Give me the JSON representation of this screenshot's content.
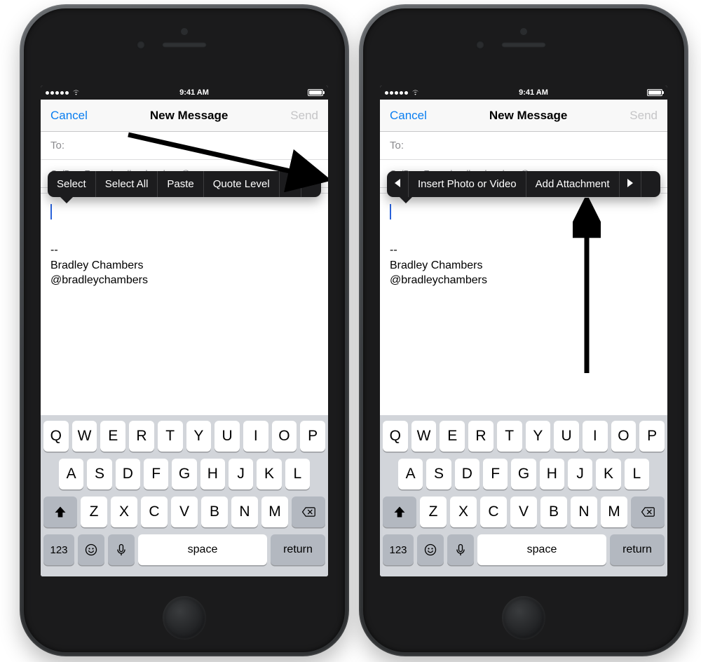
{
  "statusbar": {
    "time": "9:41 AM"
  },
  "nav": {
    "cancel": "Cancel",
    "title": "New Message",
    "send": "Send"
  },
  "fields": {
    "to_label": "To:",
    "ccbcc_label": "Cc/Bcc, From:",
    "from_value": "bradleychambers@me.com"
  },
  "signature": {
    "sep": "--",
    "line1": "Bradley Chambers",
    "line2": "@bradleychambers"
  },
  "menu_page1": {
    "select": "Select",
    "select_all": "Select All",
    "paste": "Paste",
    "quote_level": "Quote Level"
  },
  "menu_page2": {
    "insert_media": "Insert Photo or Video",
    "add_attachment": "Add Attachment"
  },
  "keyboard": {
    "row1": [
      "Q",
      "W",
      "E",
      "R",
      "T",
      "Y",
      "U",
      "I",
      "O",
      "P"
    ],
    "row2": [
      "A",
      "S",
      "D",
      "F",
      "G",
      "H",
      "J",
      "K",
      "L"
    ],
    "row3": [
      "Z",
      "X",
      "C",
      "V",
      "B",
      "N",
      "M"
    ],
    "k123": "123",
    "space": "space",
    "return": "return"
  }
}
